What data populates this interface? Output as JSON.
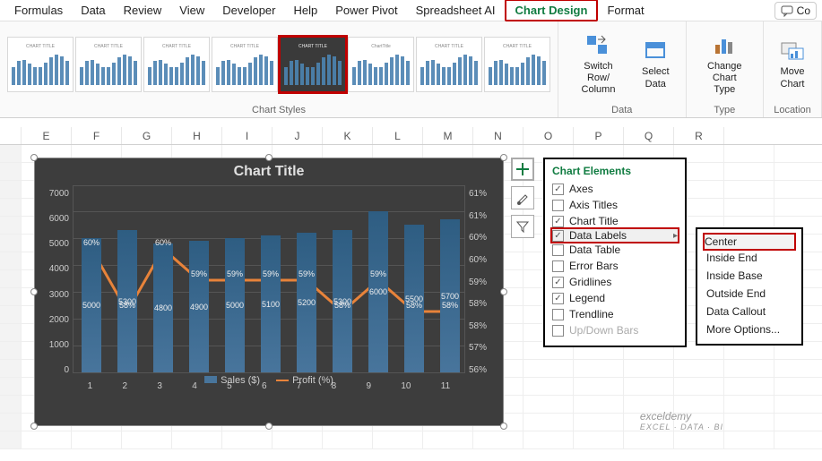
{
  "ribbon_tabs": [
    "Formulas",
    "Data",
    "Review",
    "View",
    "Developer",
    "Help",
    "Power Pivot",
    "Spreadsheet AI",
    "Chart Design",
    "Format"
  ],
  "active_tab": "Chart Design",
  "comments_label": "Co",
  "groups": {
    "styles": "Chart Styles",
    "data": "Data",
    "type": "Type",
    "location": "Location"
  },
  "buttons": {
    "switch": "Switch Row/\nColumn",
    "select_data": "Select\nData",
    "change_type": "Change\nChart Type",
    "move_chart": "Move\nChart"
  },
  "columns": [
    "",
    "E",
    "F",
    "G",
    "H",
    "I",
    "J",
    "K",
    "L",
    "M",
    "N",
    "O",
    "P",
    "Q",
    "R"
  ],
  "chart": {
    "title": "Chart Title",
    "legend_sales": "Sales ($)",
    "legend_profit": "Profit (%)"
  },
  "chart_elements": {
    "title": "Chart Elements",
    "items": [
      {
        "label": "Axes",
        "checked": true
      },
      {
        "label": "Axis Titles",
        "checked": false
      },
      {
        "label": "Chart Title",
        "checked": true
      },
      {
        "label": "Data Labels",
        "checked": true,
        "hover": true,
        "arrow": true
      },
      {
        "label": "Data Table",
        "checked": false
      },
      {
        "label": "Error Bars",
        "checked": false
      },
      {
        "label": "Gridlines",
        "checked": true
      },
      {
        "label": "Legend",
        "checked": true
      },
      {
        "label": "Trendline",
        "checked": false
      },
      {
        "label": "Up/Down Bars",
        "checked": false,
        "disabled": true
      }
    ]
  },
  "submenu": [
    "Center",
    "Inside End",
    "Inside Base",
    "Outside End",
    "Data Callout",
    "More Options..."
  ],
  "watermark": {
    "main": "exceldemy",
    "sub": "EXCEL · DATA · BI"
  },
  "chart_data": {
    "type": "bar+line (combo)",
    "categories": [
      1,
      2,
      3,
      4,
      5,
      6,
      7,
      8,
      9,
      10,
      11
    ],
    "series": [
      {
        "name": "Sales ($)",
        "type": "bar",
        "axis": "left",
        "values": [
          5000,
          5300,
          4800,
          4900,
          5000,
          5100,
          5200,
          5300,
          6000,
          5500,
          5700
        ]
      },
      {
        "name": "Profit (%)",
        "type": "line",
        "axis": "right",
        "values": [
          60,
          58,
          60,
          59,
          59,
          59,
          59,
          58,
          59,
          58,
          58
        ]
      }
    ],
    "title": "Chart Title",
    "xlabel": "",
    "ylabel_left": "",
    "ylabel_right": "",
    "ylim_left": [
      0,
      7000
    ],
    "yticks_left": [
      0,
      1000,
      2000,
      3000,
      4000,
      5000,
      6000,
      7000
    ],
    "ylim_right": [
      56,
      62
    ],
    "yticks_right": [
      "56%",
      "57%",
      "58%",
      "58%",
      "59%",
      "60%",
      "60%",
      "61%",
      "61%"
    ],
    "data_labels": {
      "bar": [
        "5000",
        "5300",
        "4800",
        "4900",
        "5000",
        "5100",
        "5200",
        "5300",
        "6000",
        "5500",
        "5700"
      ],
      "line": [
        "60%",
        "58%",
        "60%",
        "59%",
        "59%",
        "59%",
        "59%",
        "58%",
        "59%",
        "58%",
        "58%"
      ]
    }
  }
}
